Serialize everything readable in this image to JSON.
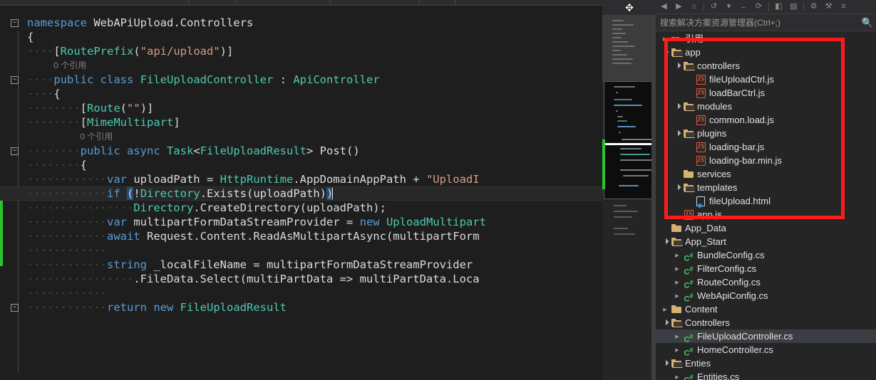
{
  "editor": {
    "language": "csharp",
    "current_line_index": 12,
    "change_bar_color": "#2fc22f",
    "lines": [
      {
        "indent": 0,
        "fold": true,
        "tokens": [
          {
            "t": "namespace",
            "c": "kw"
          },
          {
            "t": " ",
            "c": "pln"
          },
          {
            "t": "WebAPiUpload.Controllers",
            "c": "pln"
          }
        ]
      },
      {
        "indent": 0,
        "fold": false,
        "tokens": [
          {
            "t": "{",
            "c": "punc"
          }
        ]
      },
      {
        "indent": 1,
        "fold": false,
        "tokens": [
          {
            "t": "[",
            "c": "punc"
          },
          {
            "t": "RoutePrefix",
            "c": "typ"
          },
          {
            "t": "(",
            "c": "punc"
          },
          {
            "t": "\"api/upload\"",
            "c": "str"
          },
          {
            "t": ")]",
            "c": "punc"
          }
        ]
      },
      {
        "indent": 1,
        "codelens": "0 个引用"
      },
      {
        "indent": 1,
        "fold": true,
        "tokens": [
          {
            "t": "public",
            "c": "kw"
          },
          {
            "t": " ",
            "c": "pln"
          },
          {
            "t": "class",
            "c": "kw"
          },
          {
            "t": " ",
            "c": "pln"
          },
          {
            "t": "FileUploadController",
            "c": "typ"
          },
          {
            "t": " : ",
            "c": "punc"
          },
          {
            "t": "ApiController",
            "c": "typ"
          }
        ]
      },
      {
        "indent": 1,
        "fold": false,
        "tokens": [
          {
            "t": "{",
            "c": "punc"
          }
        ]
      },
      {
        "indent": 2,
        "fold": false,
        "tokens": [
          {
            "t": "[",
            "c": "punc"
          },
          {
            "t": "Route",
            "c": "typ"
          },
          {
            "t": "(",
            "c": "punc"
          },
          {
            "t": "\"\"",
            "c": "str"
          },
          {
            "t": ")]",
            "c": "punc"
          }
        ]
      },
      {
        "indent": 2,
        "fold": false,
        "tokens": [
          {
            "t": "[",
            "c": "punc"
          },
          {
            "t": "MimeMultipart",
            "c": "typ"
          },
          {
            "t": "]",
            "c": "punc"
          }
        ]
      },
      {
        "indent": 2,
        "codelens": "0 个引用"
      },
      {
        "indent": 2,
        "fold": true,
        "tokens": [
          {
            "t": "public",
            "c": "kw"
          },
          {
            "t": " ",
            "c": "pln"
          },
          {
            "t": "async",
            "c": "kw"
          },
          {
            "t": " ",
            "c": "pln"
          },
          {
            "t": "Task",
            "c": "typ"
          },
          {
            "t": "<",
            "c": "punc"
          },
          {
            "t": "FileUploadResult",
            "c": "typ"
          },
          {
            "t": "> ",
            "c": "punc"
          },
          {
            "t": "Post",
            "c": "pln"
          },
          {
            "t": "()",
            "c": "punc"
          }
        ]
      },
      {
        "indent": 2,
        "fold": false,
        "tokens": [
          {
            "t": "{",
            "c": "punc"
          }
        ]
      },
      {
        "indent": 3,
        "fold": false,
        "tokens": [
          {
            "t": "var",
            "c": "kw"
          },
          {
            "t": " uploadPath = ",
            "c": "pln"
          },
          {
            "t": "HttpRuntime",
            "c": "typ"
          },
          {
            "t": ".AppDomainAppPath + ",
            "c": "pln"
          },
          {
            "t": "\"UploadI",
            "c": "str"
          }
        ]
      },
      {
        "indent": 3,
        "current": true,
        "tokens": [
          {
            "t": "if",
            "c": "kw"
          },
          {
            "t": " ",
            "c": "pln"
          },
          {
            "t": "(",
            "c": "sel"
          },
          {
            "t": "!",
            "c": "pln"
          },
          {
            "t": "Directory",
            "c": "typ"
          },
          {
            "t": ".Exists(uploadPath)",
            "c": "pln"
          },
          {
            "t": ")",
            "c": "sel"
          }
        ]
      },
      {
        "indent": 4,
        "fold": false,
        "tokens": [
          {
            "t": "Directory",
            "c": "typ"
          },
          {
            "t": ".CreateDirectory(uploadPath);",
            "c": "pln"
          }
        ]
      },
      {
        "indent": 3,
        "fold": false,
        "tokens": [
          {
            "t": "var",
            "c": "kw"
          },
          {
            "t": " multipartFormDataStreamProvider = ",
            "c": "pln"
          },
          {
            "t": "new",
            "c": "kw"
          },
          {
            "t": " ",
            "c": "pln"
          },
          {
            "t": "UploadMultipart",
            "c": "typ"
          }
        ]
      },
      {
        "indent": 3,
        "fold": false,
        "tokens": [
          {
            "t": "await",
            "c": "kw"
          },
          {
            "t": " ",
            "c": "pln"
          },
          {
            "t": "Request",
            "c": "pln"
          },
          {
            "t": ".Content.ReadAsMultipartAsync(multipartForm",
            "c": "pln"
          }
        ]
      },
      {
        "indent": 3,
        "fold": false,
        "tokens": []
      },
      {
        "indent": 3,
        "fold": false,
        "tokens": [
          {
            "t": "string",
            "c": "kw"
          },
          {
            "t": " _localFileName = multipartFormDataStreamProvider",
            "c": "pln"
          }
        ]
      },
      {
        "indent": 4,
        "fold": false,
        "tokens": [
          {
            "t": ".FileData.Select(multiPartData => multiPartData.Loca",
            "c": "pln"
          }
        ]
      },
      {
        "indent": 3,
        "fold": false,
        "tokens": []
      },
      {
        "indent": 3,
        "fold": true,
        "tokens": [
          {
            "t": "return",
            "c": "kw"
          },
          {
            "t": " ",
            "c": "pln"
          },
          {
            "t": "new",
            "c": "kw"
          },
          {
            "t": " ",
            "c": "pln"
          },
          {
            "t": "FileUploadResult",
            "c": "typ"
          }
        ]
      }
    ]
  },
  "solution_explorer": {
    "toolbar_icons": [
      "back-arrow-icon",
      "forward-arrow-icon",
      "home-icon",
      "pending-changes-icon",
      "dropdown-icon",
      "sync-icon",
      "refresh-icon",
      "collapse-all-icon",
      "show-all-files-icon",
      "properties-icon",
      "preview-icon",
      "filter-icon"
    ],
    "search": {
      "placeholder": "搜索解决方案资源管理器(Ctrl+;)",
      "value": "",
      "icon": "search-icon"
    },
    "highlight_color": "#fc1b1b",
    "tree": [
      {
        "depth": 1,
        "twist": "closed",
        "icon": "references",
        "label": "引用"
      },
      {
        "depth": 1,
        "twist": "open",
        "icon": "folder-open",
        "label": "app"
      },
      {
        "depth": 2,
        "twist": "open",
        "icon": "folder-open",
        "label": "controllers"
      },
      {
        "depth": 3,
        "twist": "none",
        "icon": "js",
        "label": "fileUploadCtrl.js"
      },
      {
        "depth": 3,
        "twist": "none",
        "icon": "js",
        "label": "loadBarCtrl.js"
      },
      {
        "depth": 2,
        "twist": "open",
        "icon": "folder-open",
        "label": "modules"
      },
      {
        "depth": 3,
        "twist": "none",
        "icon": "js",
        "label": "common.load.js"
      },
      {
        "depth": 2,
        "twist": "open",
        "icon": "folder-open",
        "label": "plugins"
      },
      {
        "depth": 3,
        "twist": "none",
        "icon": "js",
        "label": "loading-bar.js"
      },
      {
        "depth": 3,
        "twist": "none",
        "icon": "js",
        "label": "loading-bar.min.js"
      },
      {
        "depth": 2,
        "twist": "none",
        "icon": "folder-closed",
        "label": "services"
      },
      {
        "depth": 2,
        "twist": "open",
        "icon": "folder-open",
        "label": "templates"
      },
      {
        "depth": 3,
        "twist": "none",
        "icon": "html",
        "label": "fileUpload.html"
      },
      {
        "depth": 2,
        "twist": "none",
        "icon": "js",
        "label": "app.js"
      },
      {
        "depth": 1,
        "twist": "none",
        "icon": "folder-closed",
        "label": "App_Data"
      },
      {
        "depth": 1,
        "twist": "open",
        "icon": "folder-open",
        "label": "App_Start"
      },
      {
        "depth": 2,
        "twist": "closed",
        "icon": "cs",
        "label": "BundleConfig.cs"
      },
      {
        "depth": 2,
        "twist": "closed",
        "icon": "cs",
        "label": "FilterConfig.cs"
      },
      {
        "depth": 2,
        "twist": "closed",
        "icon": "cs",
        "label": "RouteConfig.cs"
      },
      {
        "depth": 2,
        "twist": "closed",
        "icon": "cs",
        "label": "WebApiConfig.cs"
      },
      {
        "depth": 1,
        "twist": "closed",
        "icon": "folder-closed",
        "label": "Content"
      },
      {
        "depth": 1,
        "twist": "open",
        "icon": "folder-open",
        "label": "Controllers"
      },
      {
        "depth": 2,
        "twist": "closed",
        "icon": "cs",
        "label": "FileUploadController.cs",
        "selected": true
      },
      {
        "depth": 2,
        "twist": "closed",
        "icon": "cs",
        "label": "HomeController.cs"
      },
      {
        "depth": 1,
        "twist": "open",
        "icon": "folder-open",
        "label": "Enties"
      },
      {
        "depth": 2,
        "twist": "closed",
        "icon": "cs",
        "label": "Entities.cs"
      }
    ]
  },
  "minimap": {
    "split_cursor_icon": "split-cursor-icon",
    "scrollbar_marker_color": "#2fc22f"
  }
}
